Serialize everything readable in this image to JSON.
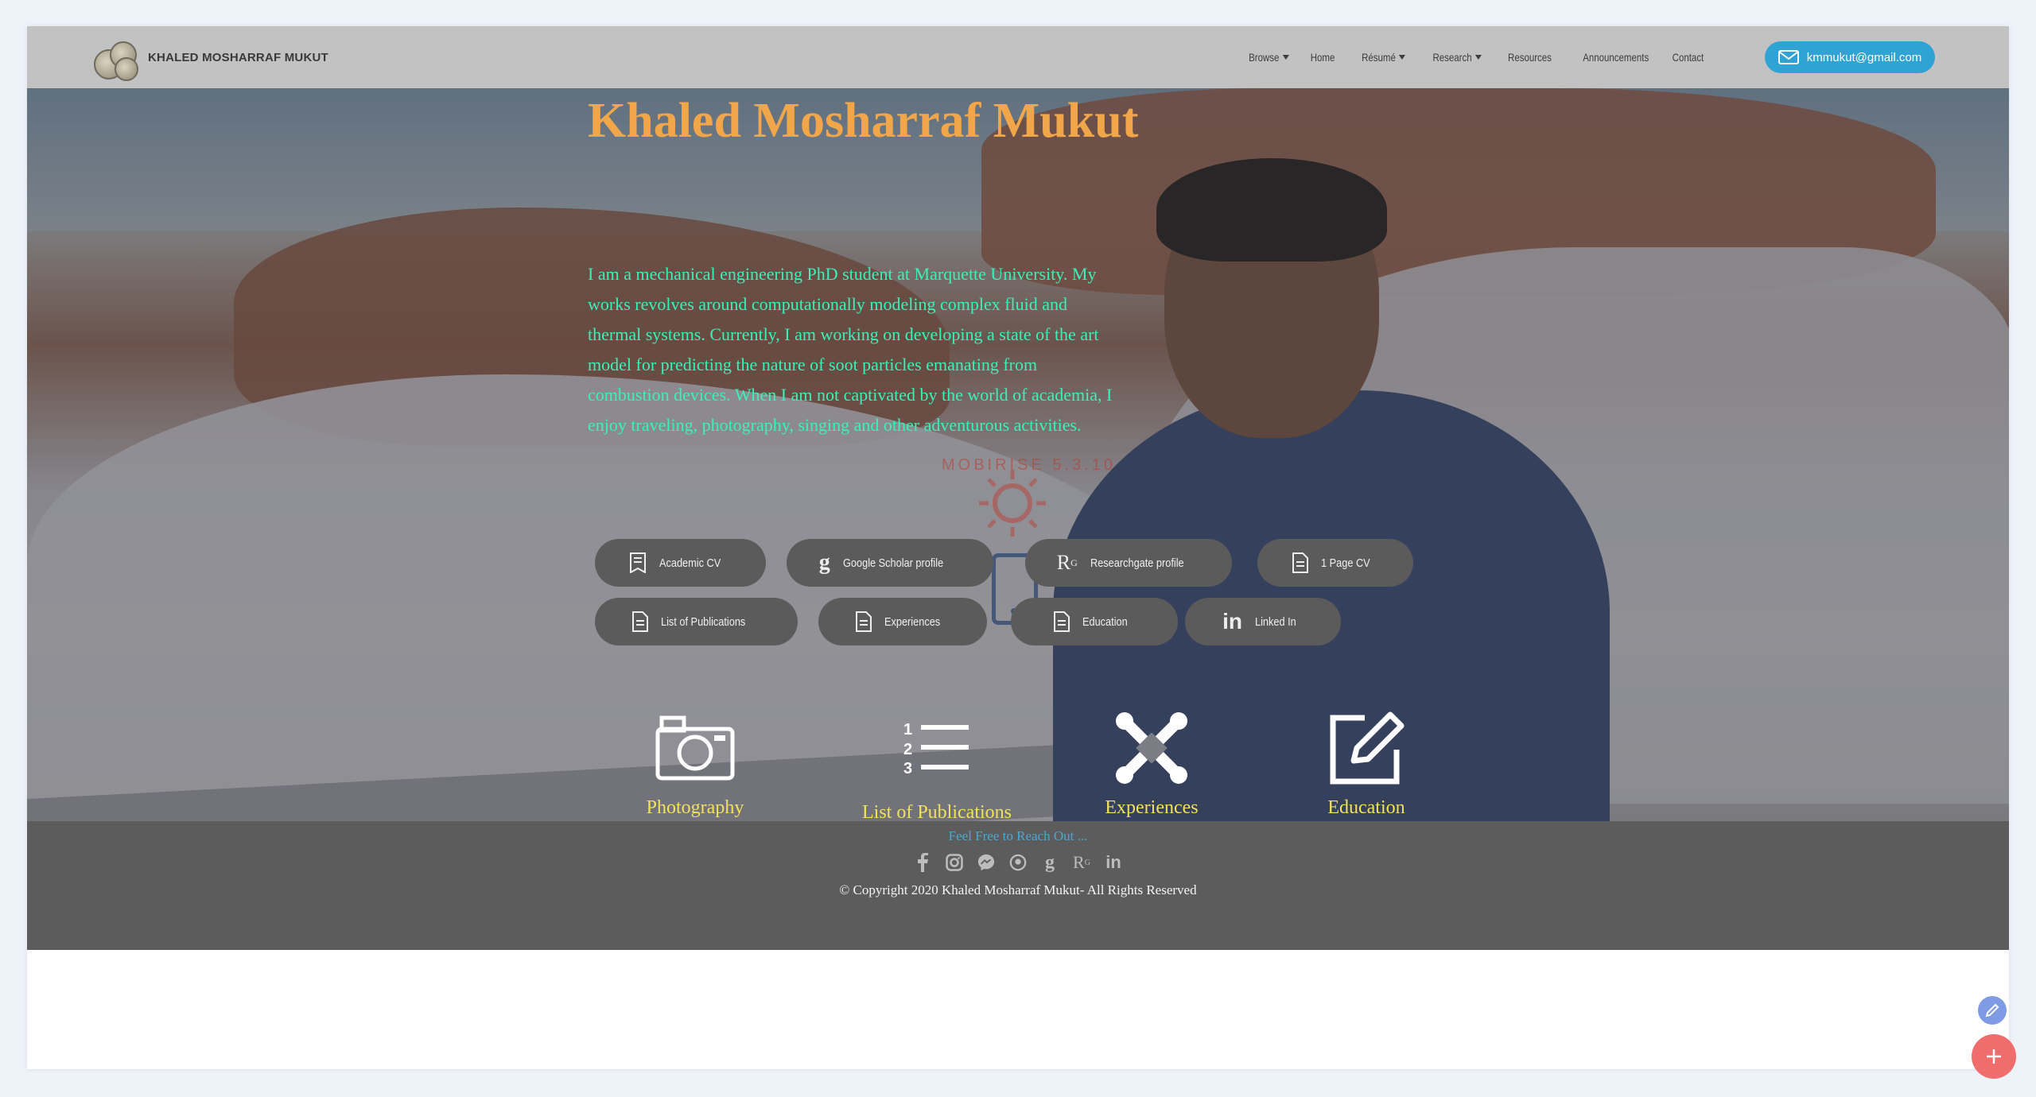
{
  "brand": {
    "name": "KHALED MOSHARRAF MUKUT"
  },
  "nav": {
    "items": [
      {
        "label": "Browse",
        "dropdown": true
      },
      {
        "label": "Home",
        "dropdown": false
      },
      {
        "label": "Résumé",
        "dropdown": true
      },
      {
        "label": "Research",
        "dropdown": true
      },
      {
        "label": "Resources",
        "dropdown": false
      },
      {
        "label": "Announcements",
        "dropdown": false
      },
      {
        "label": "Contact",
        "dropdown": false
      }
    ],
    "email_button": "kmmukut@gmail.com"
  },
  "hero": {
    "title": "Khaled Mosharraf Mukut",
    "description": "I am a mechanical engineering PhD student at Marquette University. My works revolves around computationally modeling complex fluid and thermal systems. Currently, I am working on developing a state of the art model for predicting the nature of soot particles emanating from combustion devices. When I am not captivated by the world of academia, I enjoy traveling, photography, singing and other adventurous activities.",
    "watermark": "MOBIRISE  5.3.10",
    "buttons": [
      {
        "label": "Academic CV",
        "icon": "book-icon"
      },
      {
        "label": "Google Scholar profile",
        "icon": "google-scholar-icon"
      },
      {
        "label": "Researchgate profile",
        "icon": "researchgate-icon"
      },
      {
        "label": "1 Page CV",
        "icon": "document-icon"
      },
      {
        "label": "List of Publications",
        "icon": "document-icon"
      },
      {
        "label": "Experiences",
        "icon": "document-icon"
      },
      {
        "label": "Education",
        "icon": "document-icon"
      },
      {
        "label": "Linked In",
        "icon": "linkedin-icon"
      }
    ],
    "features": [
      {
        "label": "Photography",
        "icon": "camera-icon"
      },
      {
        "label": "List of Publications",
        "icon": "numbered-list-icon"
      },
      {
        "label": "Experiences",
        "icon": "joomla-icon"
      },
      {
        "label": "Education",
        "icon": "edit-icon"
      }
    ]
  },
  "footer": {
    "reach_text": "Feel Free to Reach Out ...",
    "socials": [
      "facebook-icon",
      "instagram-icon",
      "messenger-icon",
      "github-icon",
      "google-scholar-icon",
      "researchgate-icon",
      "linkedin-icon"
    ],
    "copyright": "© Copyright 2020 Khaled Mosharraf Mukut- All Rights Reserved"
  },
  "colors": {
    "title": "#f2a64a",
    "description": "#3df0b8",
    "email_button": "#2fa3d4",
    "feature_label": "#f1e15b",
    "reach_text": "#4aa8d2"
  }
}
